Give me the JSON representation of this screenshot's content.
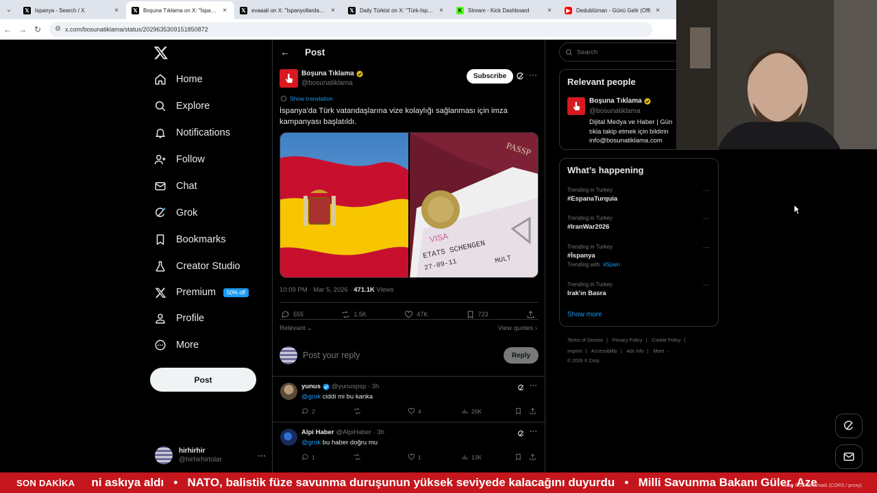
{
  "browser": {
    "tabs": [
      {
        "title": "İspanya - Search / X",
        "icon": "x-logo-icon",
        "active": false
      },
      {
        "title": "Boşuna Tıklama on X: \"İspanya",
        "icon": "x-logo-icon",
        "active": true
      },
      {
        "title": "evaaali on X: \"İspanyollardaki Y",
        "icon": "x-logo-icon",
        "active": false
      },
      {
        "title": "Daily Türkist on X: \"Türk-İspany",
        "icon": "x-logo-icon",
        "active": false
      },
      {
        "title": "Stream - Kick Dashboard",
        "icon": "kick-icon",
        "active": false
      },
      {
        "title": "Dedublüman - Günü Gelir (Offi",
        "icon": "youtube-icon",
        "active": false
      }
    ],
    "url": "x.com/bosunatiklama/status/2029635309151850872"
  },
  "nav": {
    "items": [
      {
        "label": "Home",
        "icon": "home-icon"
      },
      {
        "label": "Explore",
        "icon": "search-icon"
      },
      {
        "label": "Notifications",
        "icon": "bell-icon"
      },
      {
        "label": "Follow",
        "icon": "person-plus-icon"
      },
      {
        "label": "Chat",
        "icon": "envelope-icon"
      },
      {
        "label": "Grok",
        "icon": "grok-icon"
      },
      {
        "label": "Bookmarks",
        "icon": "bookmark-icon"
      },
      {
        "label": "Creator Studio",
        "icon": "creator-studio-icon"
      },
      {
        "label": "Premium",
        "icon": "x-logo-icon"
      },
      {
        "label": "Profile",
        "icon": "person-icon"
      },
      {
        "label": "More",
        "icon": "more-circle-icon"
      }
    ],
    "premium_badge": "50% off",
    "post_button": "Post",
    "account": {
      "name": "hirhirhir",
      "handle": "@hirhirhirtolar"
    }
  },
  "main": {
    "header_title": "Post",
    "post": {
      "author_name": "Boşuna Tıklama",
      "author_handle": "@bosunatiklama",
      "subscribe_label": "Subscribe",
      "show_translation": "Show translation",
      "text": "İspanya'da Türk vatandaşlarına vize kolaylığı sağlanması için imza kampanyası başlatıldı.",
      "media_passport_text": "PASSP",
      "media_visa_text_1": "ETATS SCHENGEN",
      "media_visa_text_2": "27-09-11",
      "media_visa_text_3": "MULT",
      "time": "10:09 PM · Mar 5, 2026",
      "views_count": "471.1K",
      "views_label": "Views",
      "replies": "555",
      "reposts": "1.5K",
      "likes": "47K",
      "bookmarks": "723"
    },
    "sort_label": "Relevant",
    "view_quotes": "View quotes",
    "reply_placeholder": "Post your reply",
    "reply_button": "Reply",
    "replies": [
      {
        "name": "yunus",
        "handle": "@yunuspsp",
        "time": "3h",
        "mention": "@grok",
        "text": "ciddi mi bu kanka",
        "replies": "2",
        "likes": "4",
        "views": "20K",
        "verified": true
      },
      {
        "name": "Alpi Haber",
        "handle": "@AlpiHaber",
        "time": "3h",
        "mention": "@grok",
        "text": "bu haber doğru mu",
        "replies": "1",
        "likes": "1",
        "views": "13K",
        "verified": false
      }
    ]
  },
  "sidebar": {
    "search_placeholder": "Search",
    "relevant_title": "Relevant people",
    "relevant_person": {
      "name": "Boşuna Tıklama",
      "handle": "@bosunatiklama",
      "bio_line1": "Dijital Medya ve Haber | Gün",
      "bio_line2": "tıkla takip etmek için bildirin",
      "bio_line3": "info@bosunatiklama.com"
    },
    "happening_title": "What’s happening",
    "trends": [
      {
        "context": "Trending in Turkey",
        "topic": "#EspanaTurquia"
      },
      {
        "context": "Trending in Turkey",
        "topic": "#IranWar2026"
      },
      {
        "context": "Trending in Turkey",
        "topic": "#İspanya",
        "with_label": "Trending with",
        "with_tag": "#Spain"
      },
      {
        "context": "Trending in Turkey",
        "topic": "Irak'ın Basra"
      }
    ],
    "show_more": "Show more",
    "footer": {
      "row1": [
        "Terms of Service",
        "Privacy Policy",
        "Cookie Policy"
      ],
      "row2": [
        "Imprint",
        "Accessibility",
        "Ads info",
        "More ···"
      ],
      "copyright": "© 2026 X Corp."
    }
  },
  "ticker": {
    "label": "SON DAKİKA",
    "text": "ni askıya aldı   •   NATO, balistik füze savunma duruşunun yüksek seviyede kalacağını duyurdu   •   Milli Savunma Bakanı Güler, Aze",
    "error": "Hata: RSS alınamadı (CORS / proxy)."
  },
  "colors": {
    "accent": "#1d9bf0",
    "brand_red": "#d71920",
    "ticker_red": "#c4161c",
    "background": "#000000"
  }
}
